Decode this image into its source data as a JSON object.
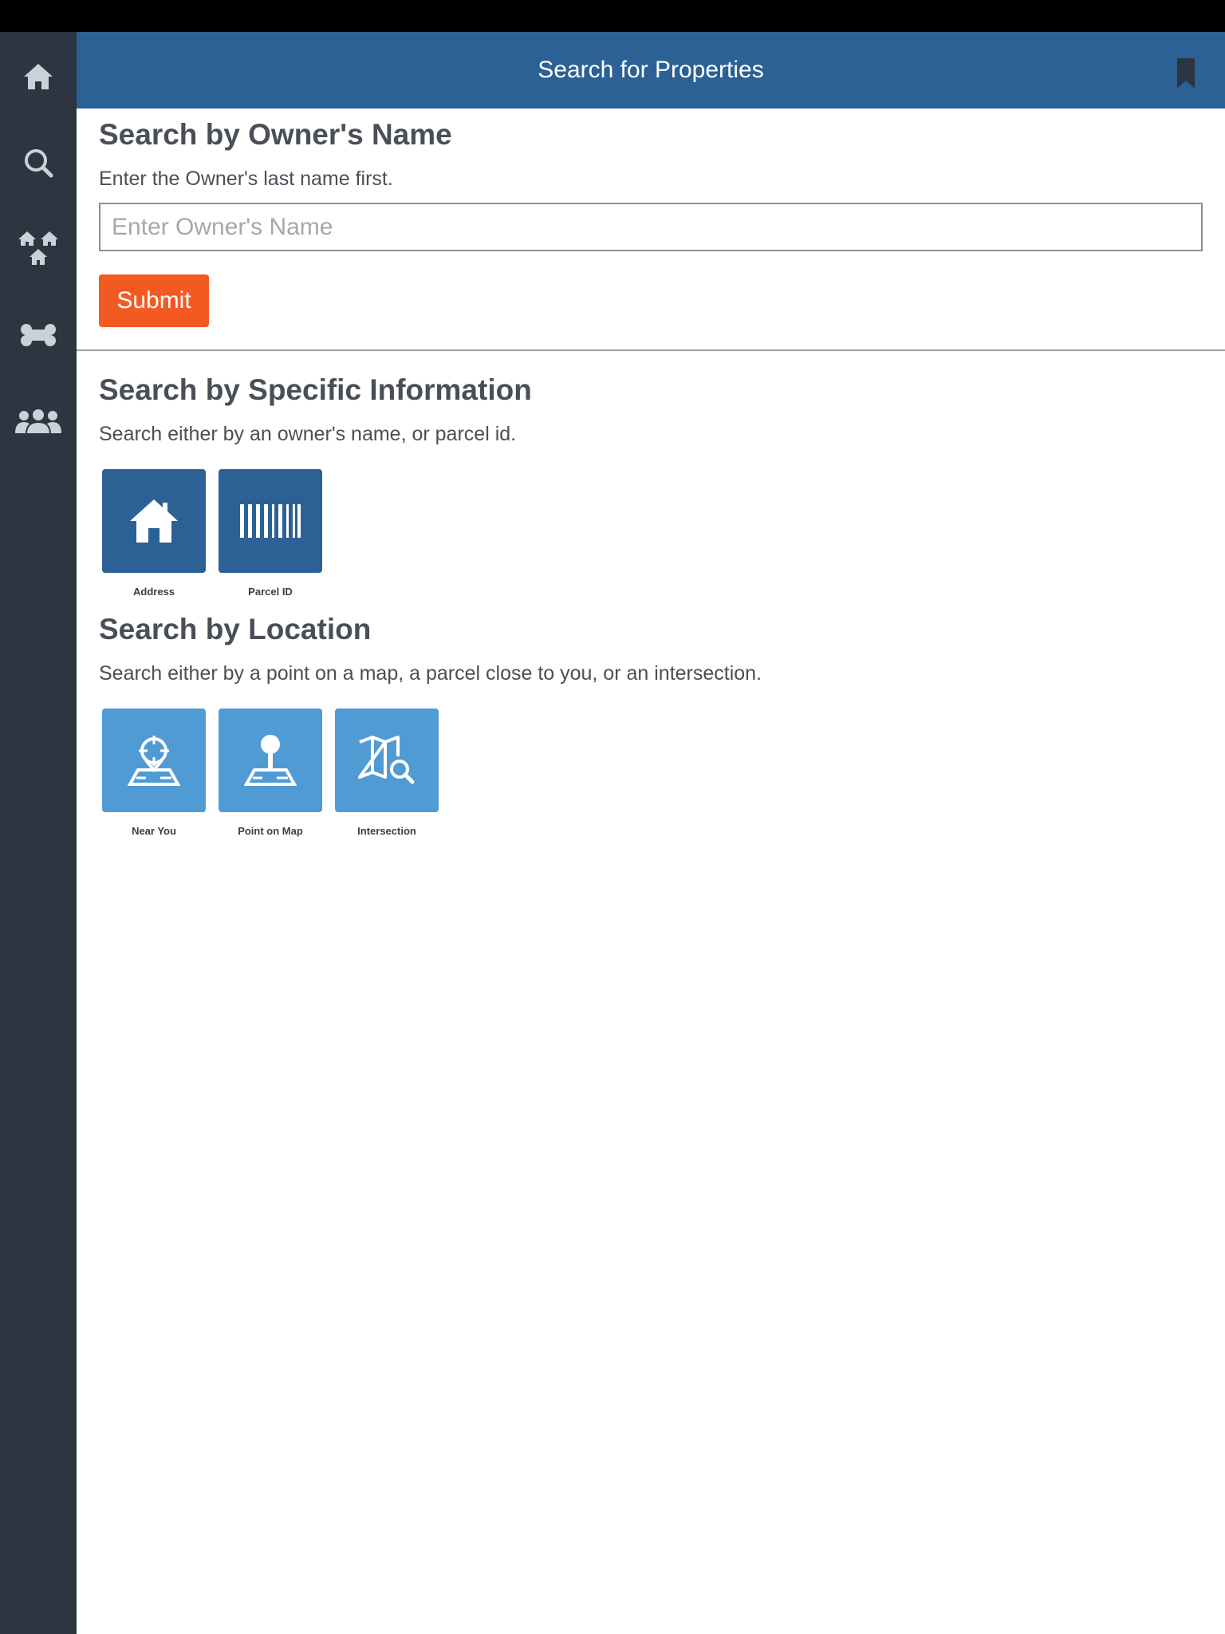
{
  "header": {
    "title": "Search for Properties"
  },
  "sidebar": {
    "items": [
      {
        "icon": "home-icon"
      },
      {
        "icon": "search-icon"
      },
      {
        "icon": "neighborhood-icon"
      },
      {
        "icon": "bone-icon"
      },
      {
        "icon": "group-icon"
      }
    ]
  },
  "owner_search": {
    "heading": "Search by Owner's Name",
    "description": "Enter the Owner's last name first.",
    "input_value": "",
    "input_placeholder": "Enter Owner's Name",
    "submit_label": "Submit"
  },
  "specific_search": {
    "heading": "Search by Specific Information",
    "description": "Search either by an owner's name, or parcel id.",
    "tiles": [
      {
        "label": "Address",
        "icon": "house-icon"
      },
      {
        "label": "Parcel ID",
        "icon": "barcode-icon"
      }
    ]
  },
  "location_search": {
    "heading": "Search by Location",
    "description": "Search either by a point on a map, a parcel close to you, or an intersection.",
    "tiles": [
      {
        "label": "Near You",
        "icon": "location-crosshair-icon"
      },
      {
        "label": "Point on Map",
        "icon": "map-pin-icon"
      },
      {
        "label": "Intersection",
        "icon": "map-search-icon"
      }
    ]
  },
  "colors": {
    "header_bg": "#2b6195",
    "sidebar_bg": "#2d3540",
    "submit_bg": "#f35a22",
    "tile_dark": "#2b6195",
    "tile_light": "#519bd4"
  }
}
